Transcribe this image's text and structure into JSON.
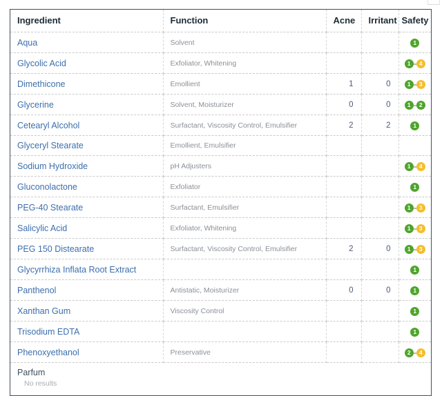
{
  "table": {
    "columns": [
      {
        "key": "ingredient",
        "label": "Ingredient"
      },
      {
        "key": "function",
        "label": "Function"
      },
      {
        "key": "acne",
        "label": "Acne"
      },
      {
        "key": "irritant",
        "label": "Irritant"
      },
      {
        "key": "safety",
        "label": "Safety"
      }
    ],
    "rows": [
      {
        "ingredient": "Aqua",
        "function": "Solvent",
        "acne": "",
        "irritant": "",
        "safety": [
          "1"
        ]
      },
      {
        "ingredient": "Glycolic Acid",
        "function": "Exfoliator, Whitening",
        "acne": "",
        "irritant": "",
        "safety": [
          "1",
          "4"
        ]
      },
      {
        "ingredient": "Dimethicone",
        "function": "Emollient",
        "acne": "1",
        "irritant": "0",
        "safety": [
          "1",
          "3"
        ]
      },
      {
        "ingredient": "Glycerine",
        "function": "Solvent, Moisturizer",
        "acne": "0",
        "irritant": "0",
        "safety": [
          "1",
          "2"
        ]
      },
      {
        "ingredient": "Cetearyl Alcohol",
        "function": "Surfactant, Viscosity Control, Emulsifier",
        "acne": "2",
        "irritant": "2",
        "safety": [
          "1"
        ]
      },
      {
        "ingredient": "Glyceryl Stearate",
        "function": "Emollient, Emulsifier",
        "acne": "",
        "irritant": "",
        "safety": []
      },
      {
        "ingredient": "Sodium Hydroxide",
        "function": "pH Adjusters",
        "acne": "",
        "irritant": "",
        "safety": [
          "1",
          "4"
        ]
      },
      {
        "ingredient": "Gluconolactone",
        "function": "Exfoliator",
        "acne": "",
        "irritant": "",
        "safety": [
          "1"
        ]
      },
      {
        "ingredient": "PEG-40 Stearate",
        "function": "Surfactant, Emulsifier",
        "acne": "",
        "irritant": "",
        "safety": [
          "1",
          "3"
        ]
      },
      {
        "ingredient": "Salicylic Acid",
        "function": "Exfoliator, Whitening",
        "acne": "",
        "irritant": "",
        "safety": [
          "1",
          "3"
        ]
      },
      {
        "ingredient": "PEG 150 Distearate",
        "function": "Surfactant, Viscosity Control, Emulsifier",
        "acne": "2",
        "irritant": "0",
        "safety": [
          "1",
          "3"
        ]
      },
      {
        "ingredient": "Glycyrrhiza Inflata Root Extract",
        "function": "",
        "acne": "",
        "irritant": "",
        "safety": [
          "1"
        ]
      },
      {
        "ingredient": "Panthenol",
        "function": "Antistatic, Moisturizer",
        "acne": "0",
        "irritant": "0",
        "safety": [
          "1"
        ]
      },
      {
        "ingredient": "Xanthan Gum",
        "function": "Viscosity Control",
        "acne": "",
        "irritant": "",
        "safety": [
          "1"
        ]
      },
      {
        "ingredient": "Trisodium EDTA",
        "function": "",
        "acne": "",
        "irritant": "",
        "safety": [
          "1"
        ]
      },
      {
        "ingredient": "Phenoxyethanol",
        "function": "Preservative",
        "acne": "",
        "irritant": "",
        "safety": [
          "2",
          "4"
        ]
      }
    ],
    "no_result_row": {
      "name": "Parfum",
      "note": "No results"
    }
  },
  "colors": {
    "link": "#3c6ead",
    "badge_green": "#4fa52c",
    "badge_yellow": "#f5be2d",
    "border": "#3f4e5a",
    "muted_text": "#8a8f96"
  }
}
